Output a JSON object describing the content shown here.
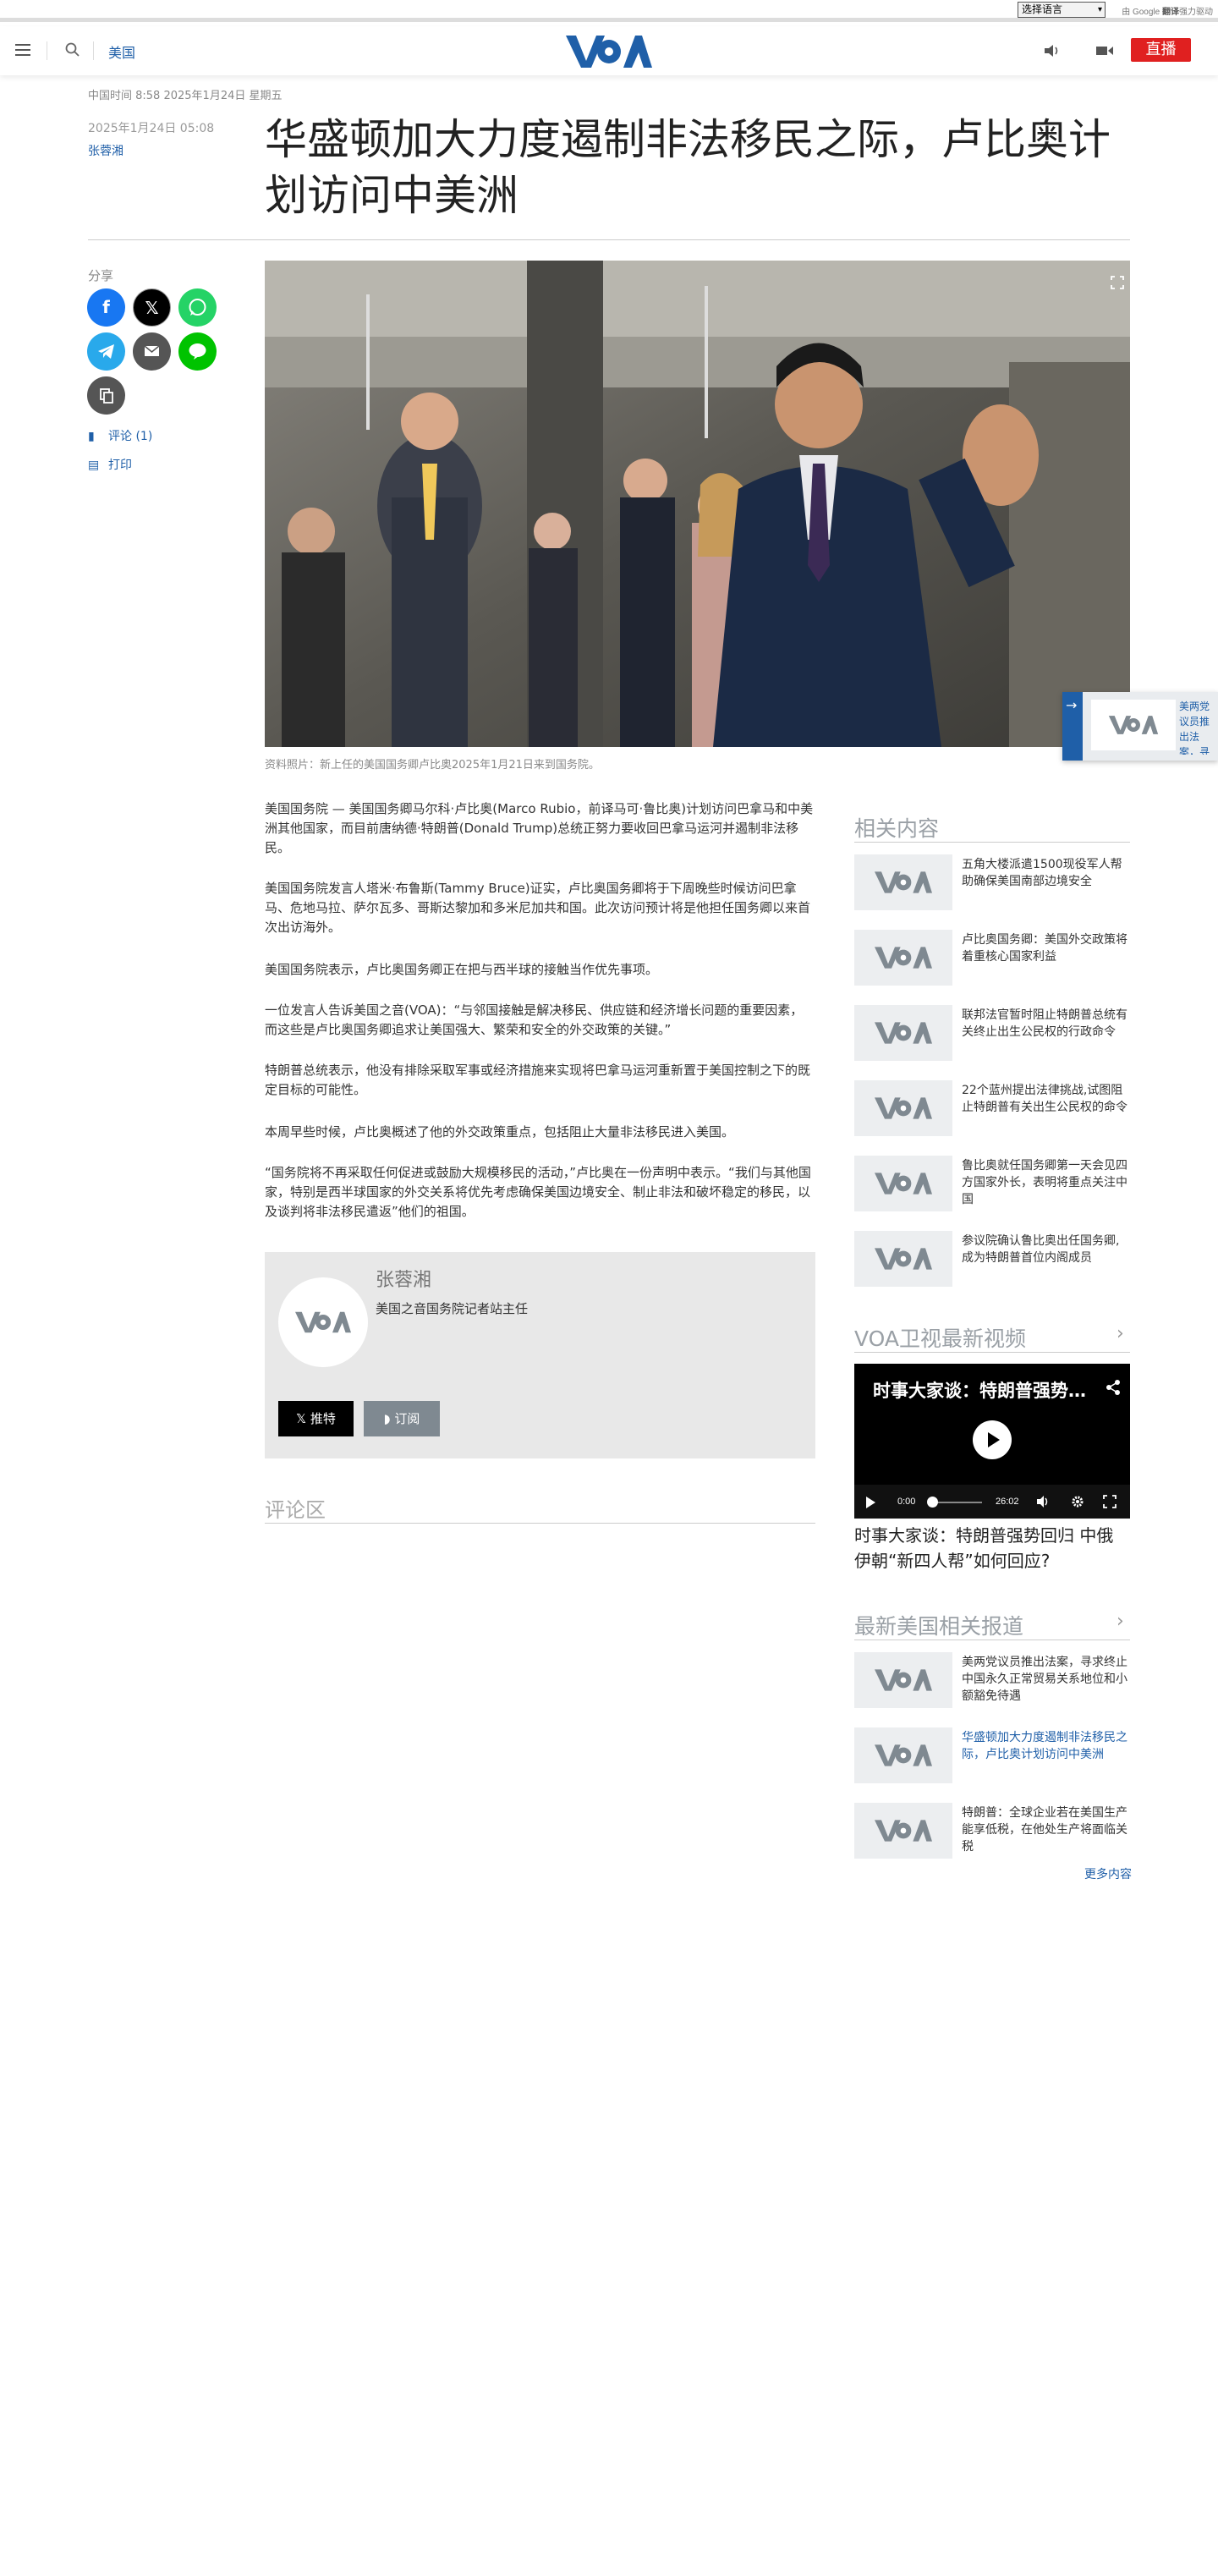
{
  "translate_bar": {
    "language_select": "选择语言",
    "powered_prefix": "由",
    "powered_brand": "Google",
    "powered_suffix_bold": "翻译",
    "powered_suffix": "强力驱动"
  },
  "header": {
    "section": "美国",
    "logo": "VOA",
    "live_label": "直播"
  },
  "article": {
    "dateline": "中国时间 8:58 2025年1月24日 星期五",
    "published": "2025年1月24日 05:08",
    "author": "张蓉湘",
    "title": "华盛顿加大力度遏制非法移民之际，卢比奥计划访问中美洲",
    "share_label": "分享",
    "comments_link": "评论 (1)",
    "print_link": "打印",
    "image_caption": "资料照片：新上任的美国国务卿卢比奥2025年1月21日来到国务院。",
    "paragraphs": [
      "美国国务院 — 美国国务卿马尔科·卢比奥(Marco Rubio，前译马可·鲁比奥)计划访问巴拿马和中美洲其他国家，而目前唐纳德·特朗普(Donald Trump)总统正努力要收回巴拿马运河并遏制非法移民。",
      "美国国务院发言人塔米·布鲁斯(Tammy Bruce)证实，卢比奥国务卿将于下周晚些时候访问巴拿马、危地马拉、萨尔瓦多、哥斯达黎加和多米尼加共和国。此次访问预计将是他担任国务卿以来首次出访海外。",
      "美国国务院表示，卢比奥国务卿正在把与西半球的接触当作优先事项。",
      "一位发言人告诉美国之音(VOA)：“与邻国接触是解决移民、供应链和经济增长问题的重要因素，而这些是卢比奥国务卿追求让美国强大、繁荣和安全的外交政策的关键。”",
      "特朗普总统表示，他没有排除采取军事或经济措施来实现将巴拿马运河重新置于美国控制之下的既定目标的可能性。",
      "本周早些时候，卢比奥概述了他的外交政策重点，包括阻止大量非法移民进入美国。",
      "“国务院将不再采取任何促进或鼓励大规模移民的活动，”卢比奥在一份声明中表示。“我们与其他国家，特别是西半球国家的外交关系将优先考虑确保美国边境安全、制止非法和破坏稳定的移民，以及谈判将非法移民遣返”他们的祖国。"
    ],
    "author_box": {
      "name": "张蓉湘",
      "role": "美国之音国务院记者站主任",
      "follow_label": "推特",
      "subscribe_label": "订阅"
    },
    "comments_title": "评论区"
  },
  "sidebar": {
    "related_title": "相关内容",
    "related": [
      "五角大楼派遣1500现役军人帮助确保美国南部边境安全",
      "卢比奥国务卿：美国外交政策将着重核心国家利益",
      "联邦法官暂时阻止特朗普总统有关终止出生公民权的行政命令",
      "22个蓝州提出法律挑战,试图阻止特朗普有关出生公民权的命令",
      "鲁比奥就任国务卿第一天会见四方国家外长，表明将重点关注中国",
      "参议院确认鲁比奥出任国务卿,成为特朗普首位内阁成员"
    ],
    "video_section_title": "VOA卫视最新视频",
    "video": {
      "overlay_title": "时事大家谈：特朗普强势…",
      "current_time": "0:00",
      "duration": "26:02",
      "caption": "时事大家谈：特朗普强势回归 中俄伊朝“新四人帮”如何回应?"
    },
    "latest_title": "最新美国相关报道",
    "latest": [
      "美两党议员推出法案，寻求终止中国永久正常贸易关系地位和小额豁免待遇",
      "华盛顿加大力度遏制非法移民之际，卢比奥计划访问中美洲",
      "特朗普：全球企业若在美国生产能享低税，在他处生产将面临关税"
    ],
    "more_label": "更多内容"
  },
  "float_widget": {
    "text": "美两党议员推出法案，寻求终止中国永久正常贸易关系地位和小额豁免待遇"
  }
}
